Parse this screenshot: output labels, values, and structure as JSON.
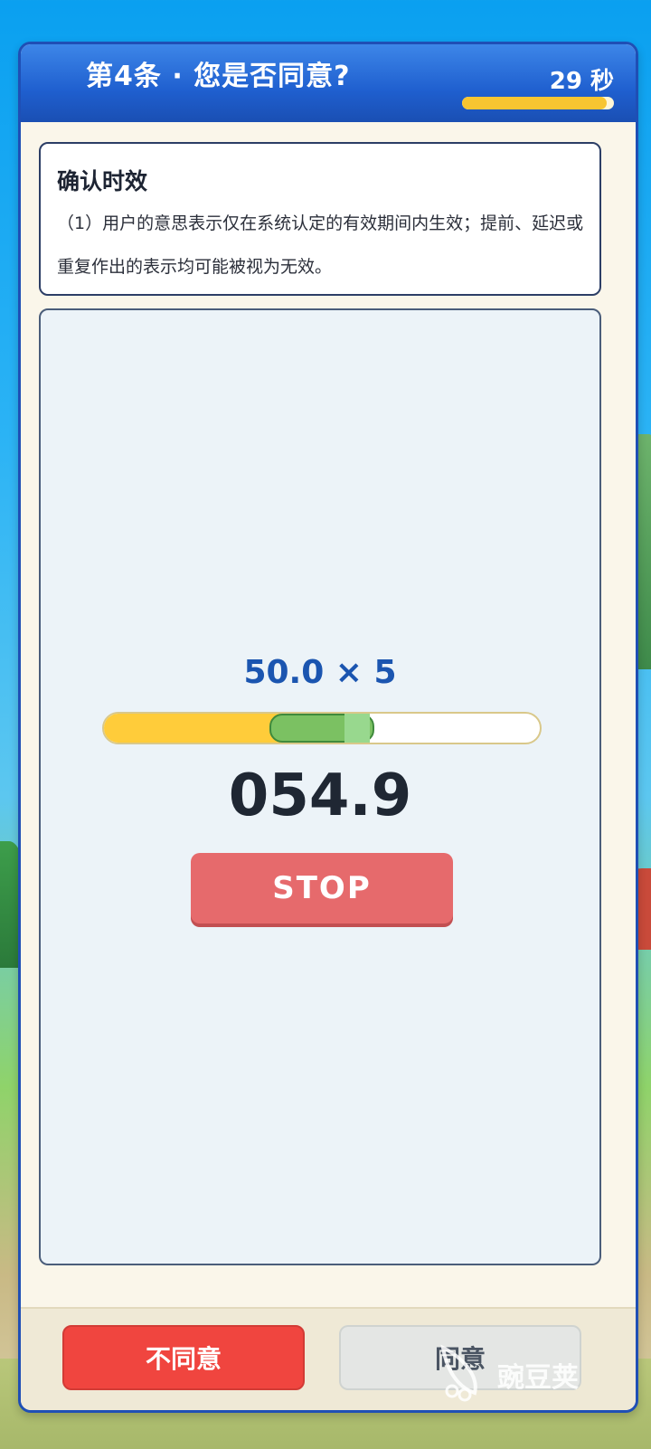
{
  "header": {
    "title": "第4条 · 您是否同意?",
    "timer_label": "29 秒",
    "timer_remaining_fraction": 0.95
  },
  "clause": {
    "title": "确认时效",
    "body": "（1）用户的意思表示仅在系统认定的有效期间内生效；提前、延迟或重复作出的表示均可能被视为无效。"
  },
  "game": {
    "target_label": "50.0 × 5",
    "meter": {
      "fill_fraction": 0.52,
      "zone_start_fraction": 0.38,
      "zone_end_fraction": 0.62
    },
    "reading": "054.9",
    "stop_label": "STOP"
  },
  "footer": {
    "disagree_label": "不同意",
    "agree_label": "同意"
  },
  "watermark": {
    "text": "豌豆荚"
  },
  "colors": {
    "accent_blue": "#1f5fcf",
    "timer_yellow": "#f7c531",
    "stop_red": "#e66a6c",
    "disagree_red": "#f0453f",
    "zone_green": "#7bc162"
  }
}
